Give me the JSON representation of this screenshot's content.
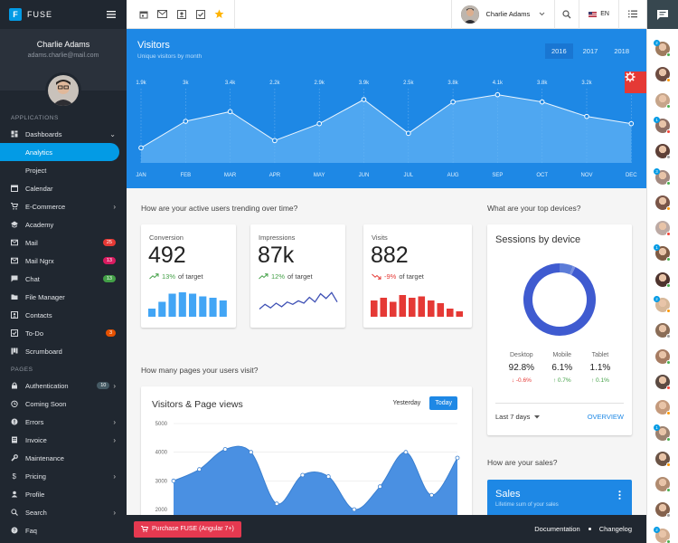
{
  "app": {
    "name": "FUSE"
  },
  "user": {
    "name": "Charlie Adams",
    "email": "adams.charlie@mail.com"
  },
  "nav": {
    "applications_title": "APPLICATIONS",
    "pages_title": "PAGES",
    "items": [
      {
        "label": "Dashboards",
        "icon": "dashboard-icon",
        "chev": "⌄"
      },
      {
        "label": "Analytics",
        "sub": true,
        "active": true
      },
      {
        "label": "Project",
        "sub": true
      },
      {
        "label": "Calendar",
        "icon": "calendar-icon"
      },
      {
        "label": "E-Commerce",
        "icon": "cart-icon",
        "chev": "›"
      },
      {
        "label": "Academy",
        "icon": "school-icon"
      },
      {
        "label": "Mail",
        "icon": "mail-icon",
        "badge": "25",
        "badge_color": "#e53935"
      },
      {
        "label": "Mail Ngrx",
        "icon": "mail-icon",
        "badge": "13",
        "badge_color": "#d81b60"
      },
      {
        "label": "Chat",
        "icon": "chat-icon",
        "badge": "13",
        "badge_color": "#43a047"
      },
      {
        "label": "File Manager",
        "icon": "folder-icon"
      },
      {
        "label": "Contacts",
        "icon": "contacts-icon"
      },
      {
        "label": "To-Do",
        "icon": "checkbox-icon",
        "badge": "3",
        "badge_color": "#e65100"
      },
      {
        "label": "Scrumboard",
        "icon": "board-icon"
      }
    ],
    "page_items": [
      {
        "label": "Authentication",
        "icon": "lock-icon",
        "badge": "10",
        "badge_color": "#455a64",
        "chev": "›"
      },
      {
        "label": "Coming Soon",
        "icon": "alarm-icon"
      },
      {
        "label": "Errors",
        "icon": "error-icon",
        "chev": "›"
      },
      {
        "label": "Invoice",
        "icon": "invoice-icon",
        "chev": "›"
      },
      {
        "label": "Maintenance",
        "icon": "wrench-icon"
      },
      {
        "label": "Pricing",
        "icon": "dollar-icon",
        "chev": "›"
      },
      {
        "label": "Profile",
        "icon": "person-icon"
      },
      {
        "label": "Search",
        "icon": "search-icon",
        "chev": "›"
      },
      {
        "label": "Faq",
        "icon": "help-icon"
      }
    ]
  },
  "topbar": {
    "user_name": "Charlie Adams",
    "language": "EN"
  },
  "visitors": {
    "title": "Visitors",
    "subtitle": "Unique visitors by month",
    "years": [
      "2016",
      "2017",
      "2018"
    ],
    "selected_year": "2016"
  },
  "chart_data": [
    {
      "type": "area",
      "categories": [
        "JAN",
        "FEB",
        "MAR",
        "APR",
        "MAY",
        "JUN",
        "JUL",
        "AUG",
        "SEP",
        "OCT",
        "NOV",
        "DEC"
      ],
      "values": [
        1.9,
        3.0,
        3.4,
        2.2,
        2.9,
        3.9,
        2.5,
        3.8,
        4.1,
        3.8,
        3.2,
        2.9
      ],
      "labels": [
        "1.9k",
        "3k",
        "3.4k",
        "2.2k",
        "2.9k",
        "3.9k",
        "2.5k",
        "3.8k",
        "4.1k",
        "3.8k",
        "3.2k",
        "2.9k"
      ],
      "title": "Visitors",
      "subtitle": "Unique visitors by month"
    },
    {
      "type": "area",
      "title": "Visitors & Page views",
      "yticks": [
        "5000",
        "4000",
        "3000",
        "2000"
      ],
      "ylim": [
        1900,
        5100
      ],
      "values": [
        3000,
        3400,
        4100,
        4000,
        2200,
        3200,
        3150,
        2000,
        2800,
        4000,
        2500,
        3800
      ]
    }
  ],
  "questions": {
    "active_users": "How are your active users trending over time?",
    "devices": "What are your top devices?",
    "pages": "How many pages your users visit?",
    "sales": "How are your sales?"
  },
  "stats": [
    {
      "title": "Conversion",
      "value": "492",
      "delta": "13%",
      "suffix": "of target",
      "trend": "up",
      "chart": "bar",
      "color": "#42a5f5",
      "bars": [
        0.3,
        0.55,
        0.85,
        0.9,
        0.85,
        0.75,
        0.7,
        0.6
      ]
    },
    {
      "title": "Impressions",
      "value": "87k",
      "delta": "12%",
      "suffix": "of target",
      "trend": "up",
      "chart": "line",
      "color": "#3f51b5",
      "points": [
        0.25,
        0.45,
        0.3,
        0.5,
        0.35,
        0.55,
        0.45,
        0.6,
        0.5,
        0.75,
        0.55,
        0.9,
        0.7,
        0.95,
        0.55
      ]
    },
    {
      "title": "Visits",
      "value": "882",
      "delta": "-9%",
      "suffix": "of target",
      "trend": "down",
      "chart": "bar",
      "color": "#e53935",
      "bars": [
        0.6,
        0.7,
        0.55,
        0.8,
        0.7,
        0.75,
        0.6,
        0.5,
        0.3,
        0.2
      ]
    }
  ],
  "devices": {
    "title": "Sessions by device",
    "items": [
      {
        "name": "Desktop",
        "percent": "92.8%",
        "change": "-0.6%",
        "trend": "down"
      },
      {
        "name": "Mobile",
        "percent": "6.1%",
        "change": "0.7%",
        "trend": "up"
      },
      {
        "name": "Tablet",
        "percent": "1.1%",
        "change": "0.1%",
        "trend": "up"
      }
    ],
    "donut": [
      92.8,
      6.1,
      1.1
    ],
    "range": "Last 7 days",
    "overview": "OVERVIEW"
  },
  "visits_card": {
    "title": "Visitors & Page views",
    "tabs": [
      "Yesterday",
      "Today"
    ],
    "selected_tab": "Today"
  },
  "sales": {
    "title": "Sales",
    "subtitle": "Lifetime sum of your sales"
  },
  "footer": {
    "buy": "Purchase FUSE (Angular 7+)",
    "documentation": "Documentation",
    "changelog": "Changelog"
  },
  "colors": {
    "primary": "#1e88e5",
    "sidebar": "#202730",
    "accent": "#039be5"
  }
}
